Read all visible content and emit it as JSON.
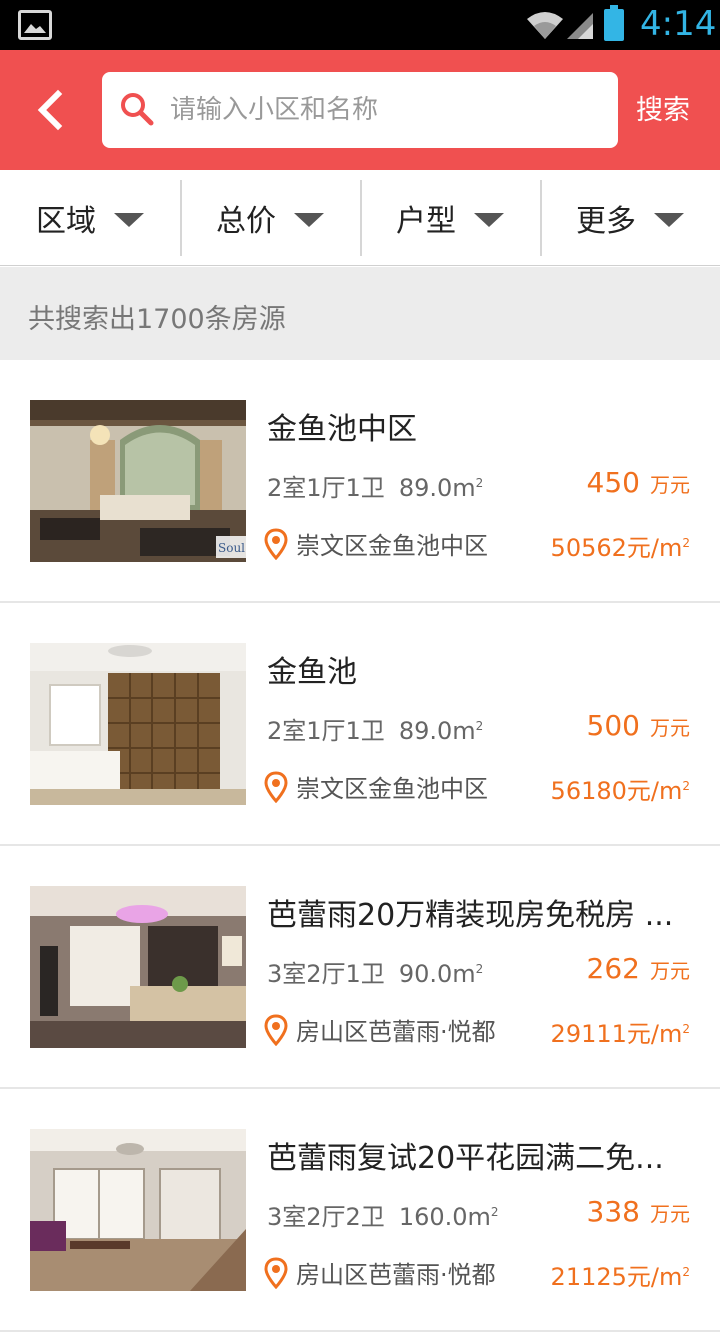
{
  "status_bar": {
    "time": "4:14"
  },
  "header": {
    "search_placeholder": "请输入小区和名称",
    "search_button": "搜索"
  },
  "filters": [
    {
      "label": "区域"
    },
    {
      "label": "总价"
    },
    {
      "label": "户型"
    },
    {
      "label": "更多"
    }
  ],
  "result_summary": "共搜索出1700条房源",
  "listings": [
    {
      "title": "金鱼池中区",
      "layout": "2室1厅1卫",
      "area": "89.0m",
      "price": "450",
      "price_unit": "万元",
      "location": "崇文区金鱼池中区",
      "unit_price": "50562元/m"
    },
    {
      "title": "金鱼池",
      "layout": "2室1厅1卫",
      "area": "89.0m",
      "price": "500",
      "price_unit": "万元",
      "location": "崇文区金鱼池中区",
      "unit_price": "56180元/m"
    },
    {
      "title": "芭蕾雨20万精装现房免税房 ...",
      "layout": "3室2厅1卫",
      "area": "90.0m",
      "price": "262",
      "price_unit": "万元",
      "location": "房山区芭蕾雨·悦都",
      "unit_price": "29111元/m"
    },
    {
      "title": "芭蕾雨复试20平花园满二免...",
      "layout": "3室2厅2卫",
      "area": "160.0m",
      "price": "338",
      "price_unit": "万元",
      "location": "房山区芭蕾雨·悦都",
      "unit_price": "21125元/m"
    }
  ],
  "sup_mark": "2",
  "colors": {
    "header_bg": "#f05050",
    "accent_orange": "#f0701e",
    "status_blue": "#33b5e5"
  }
}
